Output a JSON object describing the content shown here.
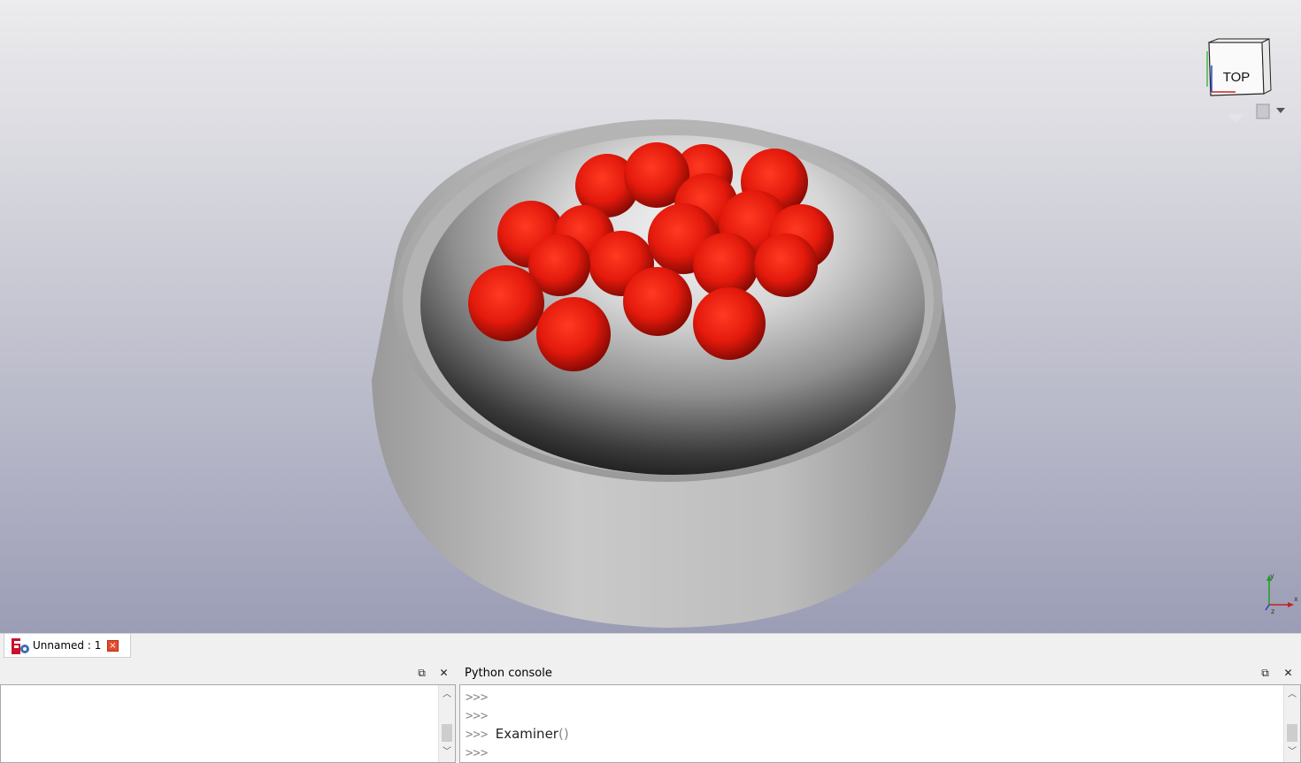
{
  "viewport": {
    "navcube": {
      "face_label": "TOP",
      "icon": "view-cube-icon",
      "menu_icon": "view-menu-icon"
    },
    "axis": {
      "x_label": "x",
      "y_label": "y",
      "z_label": "z"
    },
    "colors": {
      "sphere": "#e02010",
      "bowl": "#b8b8b8"
    }
  },
  "document_tab": {
    "icon": "freecad-logo-icon",
    "label": "Unnamed : 1",
    "close_icon": "close-icon"
  },
  "report_panel": {
    "title": ""
  },
  "python_console": {
    "title": "Python console",
    "lines": [
      {
        "prompt": ">>>",
        "command": "",
        "paren": ""
      },
      {
        "prompt": ">>>",
        "command": "",
        "paren": ""
      },
      {
        "prompt": ">>>",
        "command": "Examiner",
        "paren": "()"
      },
      {
        "prompt": ">>>",
        "command": "",
        "paren": ""
      }
    ]
  }
}
